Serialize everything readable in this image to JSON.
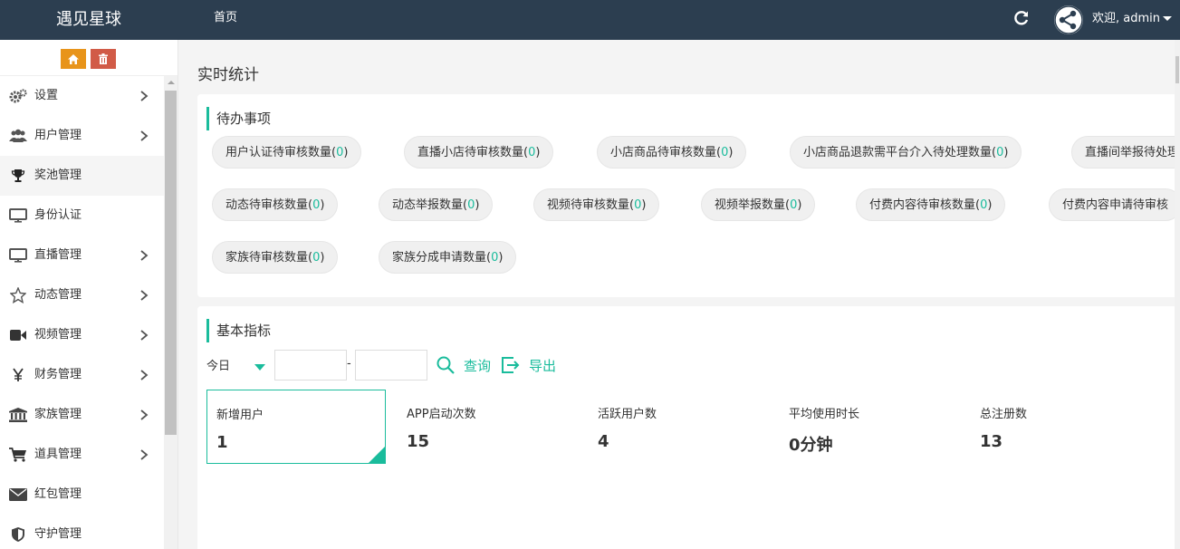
{
  "header": {
    "brand": "遇见星球",
    "nav_home": "首页",
    "welcome": "欢迎, admin",
    "accent": "#2c3e50"
  },
  "sidebar": {
    "items": [
      {
        "label": "设置",
        "icon": "cogs-icon",
        "has_children": true
      },
      {
        "label": "用户管理",
        "icon": "users-icon",
        "has_children": true
      },
      {
        "label": "奖池管理",
        "icon": "trophy-icon",
        "has_children": false,
        "active": true
      },
      {
        "label": "身份认证",
        "icon": "desktop-icon",
        "has_children": false
      },
      {
        "label": "直播管理",
        "icon": "desktop-icon",
        "has_children": true
      },
      {
        "label": "动态管理",
        "icon": "star-icon",
        "has_children": true
      },
      {
        "label": "视频管理",
        "icon": "video-camera-icon",
        "has_children": true
      },
      {
        "label": "财务管理",
        "icon": "yen-icon",
        "has_children": true
      },
      {
        "label": "家族管理",
        "icon": "bank-icon",
        "has_children": true
      },
      {
        "label": "道具管理",
        "icon": "cart-icon",
        "has_children": true
      },
      {
        "label": "红包管理",
        "icon": "envelope-icon",
        "has_children": false
      },
      {
        "label": "守护管理",
        "icon": "shield-icon",
        "has_children": false
      }
    ]
  },
  "main": {
    "page_title": "实时统计",
    "todo": {
      "title": "待办事项",
      "items": [
        {
          "label": "用户认证待审核数量(",
          "count": "0",
          "suffix": ")"
        },
        {
          "label": "直播小店待审核数量(",
          "count": "0",
          "suffix": ")"
        },
        {
          "label": "小店商品待审核数量(",
          "count": "0",
          "suffix": ")"
        },
        {
          "label": "小店商品退款需平台介入待处理数量(",
          "count": "0",
          "suffix": ")"
        },
        {
          "label": "直播间举报待处理",
          "count": "",
          "suffix": ""
        },
        {
          "label": "动态待审核数量(",
          "count": "0",
          "suffix": ")"
        },
        {
          "label": "动态举报数量(",
          "count": "0",
          "suffix": ")"
        },
        {
          "label": "视频待审核数量(",
          "count": "0",
          "suffix": ")"
        },
        {
          "label": "视频举报数量(",
          "count": "0",
          "suffix": ")"
        },
        {
          "label": "付费内容待审核数量(",
          "count": "0",
          "suffix": ")"
        },
        {
          "label": "付费内容申请待审核",
          "count": "",
          "suffix": ""
        },
        {
          "label": "家族待审核数量(",
          "count": "0",
          "suffix": ")"
        },
        {
          "label": "家族分成申请数量(",
          "count": "0",
          "suffix": ")"
        }
      ]
    },
    "metrics": {
      "title": "基本指标",
      "period": "今日",
      "date_sep": "-",
      "query_label": "查询",
      "export_label": "导出",
      "stats": [
        {
          "label": "新增用户",
          "value": "1"
        },
        {
          "label": "APP启动次数",
          "value": "15"
        },
        {
          "label": "活跃用户数",
          "value": "4"
        },
        {
          "label": "平均使用时长",
          "value": "0分钟"
        },
        {
          "label": "总注册数",
          "value": "13"
        }
      ]
    }
  },
  "colors": {
    "accent": "#1abc9c",
    "home_btn": "#e8941a",
    "trash_btn": "#d15b47"
  }
}
